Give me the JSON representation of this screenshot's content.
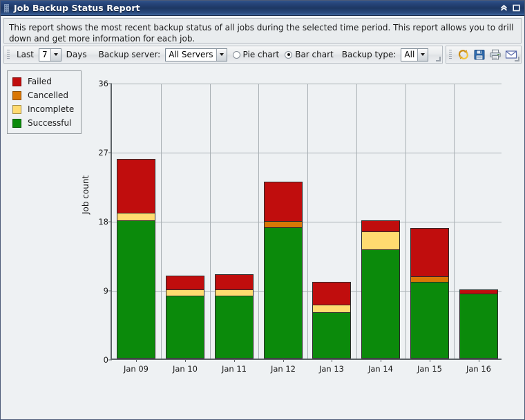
{
  "window": {
    "title": "Job Backup Status Report",
    "controls": [
      {
        "name": "collapse-button",
        "icon": "double-chevron-up-icon"
      },
      {
        "name": "maximize-button",
        "icon": "square-icon"
      }
    ]
  },
  "description": "This report shows the most recent backup status of all jobs during the selected time period. This report allows you to drill down and get more information for each job.",
  "toolbar": {
    "last_label": "Last",
    "days_value": "7",
    "days_label": "Days",
    "backup_server_label": "Backup server:",
    "backup_server_value": "All Servers",
    "pie_chart_label": "Pie chart",
    "bar_chart_label": "Bar chart",
    "chart_type_selected": "Bar chart",
    "backup_type_label": "Backup type:",
    "backup_type_value": "All",
    "actions": [
      {
        "name": "refresh-icon",
        "label": "Refresh"
      },
      {
        "name": "save-icon",
        "label": "Save"
      },
      {
        "name": "print-icon",
        "label": "Print"
      },
      {
        "name": "email-icon",
        "label": "Email"
      }
    ]
  },
  "chart_data": {
    "type": "bar",
    "stacked": true,
    "title": "",
    "xlabel": "",
    "ylabel": "Job count",
    "ylim": [
      0,
      36
    ],
    "yticks": [
      0,
      9,
      18,
      27,
      36
    ],
    "grid": true,
    "legend_position": "top-left",
    "categories": [
      "Jan 09",
      "Jan 10",
      "Jan 11",
      "Jan 12",
      "Jan 13",
      "Jan 14",
      "Jan 15",
      "Jan 16"
    ],
    "series": [
      {
        "name": "Successful",
        "color": "#0b8a0b",
        "values": [
          18,
          8.2,
          8.2,
          17.1,
          6,
          14.2,
          10,
          8.5
        ]
      },
      {
        "name": "Incomplete",
        "color": "#ffdb70",
        "values": [
          1,
          0.8,
          0.8,
          0,
          1,
          2.4,
          0,
          0
        ]
      },
      {
        "name": "Cancelled",
        "color": "#d97706",
        "values": [
          0,
          0,
          0,
          0.8,
          0,
          0,
          0.7,
          0
        ]
      },
      {
        "name": "Failed",
        "color": "#c00d0d",
        "values": [
          7,
          1.8,
          2,
          5.1,
          3,
          1.4,
          6.3,
          0.5
        ]
      }
    ],
    "totals": [
      26,
      10.8,
      11,
      23,
      10,
      18,
      17,
      9
    ]
  },
  "legend": {
    "items": [
      {
        "label": "Failed",
        "color": "#c00d0d"
      },
      {
        "label": "Cancelled",
        "color": "#d97706"
      },
      {
        "label": "Incomplete",
        "color": "#ffdb70"
      },
      {
        "label": "Successful",
        "color": "#0b8a0b"
      }
    ]
  }
}
